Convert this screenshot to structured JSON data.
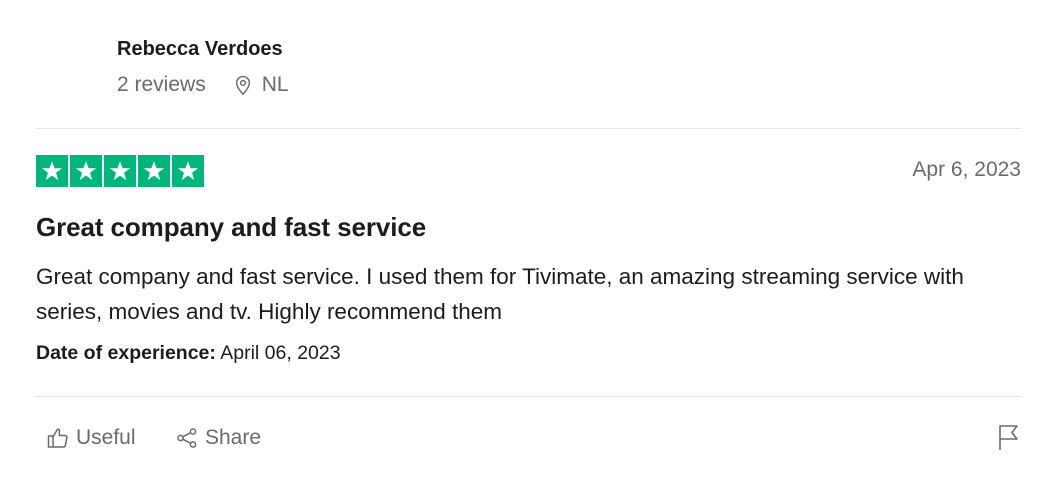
{
  "reviewer": {
    "name": "Rebecca Verdoes",
    "reviews_count": "2 reviews",
    "country": "NL",
    "location_icon": "location-pin-icon"
  },
  "rating": {
    "stars": 5,
    "max_stars": 5,
    "star_color": "#00b67a"
  },
  "review": {
    "date": "Apr 6, 2023",
    "title": "Great company and fast service",
    "body": "Great company and fast service. I used them for Tivimate, an amazing streaming service with series, movies and tv. Highly recommend them",
    "experience_label": "Date of experience:",
    "experience_date": " April 06, 2023"
  },
  "actions": {
    "useful_label": "Useful",
    "useful_icon": "thumbs-up-icon",
    "share_label": "Share",
    "share_icon": "share-icon",
    "report_icon": "flag-icon"
  },
  "colors": {
    "text": "#1c1c1c",
    "muted": "#6b6b6b",
    "divider": "#e3e3e3"
  }
}
